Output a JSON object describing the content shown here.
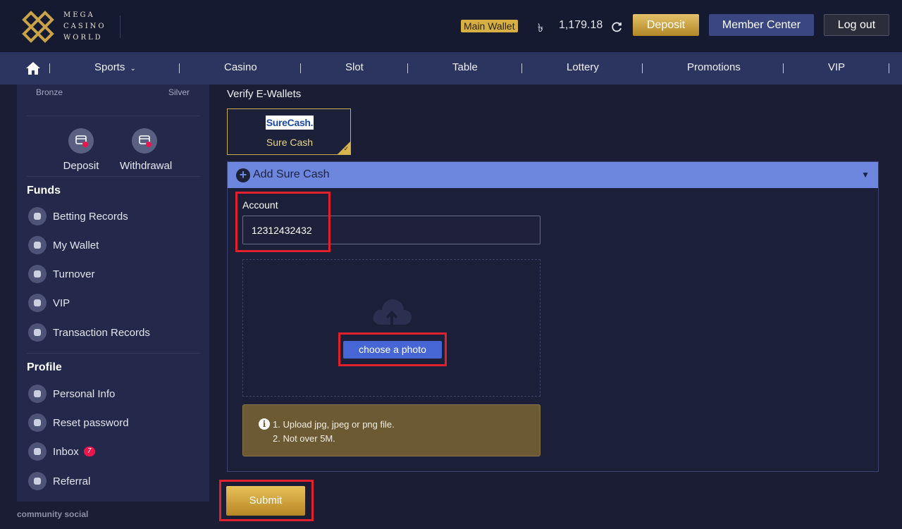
{
  "header": {
    "brand_line1": "MEGA",
    "brand_line2": "CASINO",
    "brand_line3": "WORLD",
    "wallet_label": "Main Wallet",
    "currency_symbol": "৳",
    "balance": "1,179.18",
    "deposit_label": "Deposit",
    "member_center_label": "Member Center",
    "logout_label": "Log out"
  },
  "nav": {
    "items": [
      "Sports",
      "Casino",
      "Slot",
      "Table",
      "Lottery",
      "Promotions",
      "VIP"
    ]
  },
  "sidebar": {
    "tier_left": "Bronze",
    "tier_right": "Silver",
    "quick": [
      "Deposit",
      "Withdrawal"
    ],
    "funds_title": "Funds",
    "funds_items": [
      "Betting Records",
      "My Wallet",
      "Turnover",
      "VIP",
      "Transaction Records"
    ],
    "profile_title": "Profile",
    "profile_items": [
      "Personal Info",
      "Reset password",
      "Inbox",
      "Referral"
    ],
    "inbox_count": "7",
    "community": "community social"
  },
  "main": {
    "title": "Verify E-Wallets",
    "wallet_logo_text": "SureCash.",
    "wallet_name": "Sure Cash",
    "panel_title": "Add Sure Cash",
    "account_label": "Account",
    "account_value": "12312432432",
    "choose_photo_label": "choose a photo",
    "note_line1": "1. Upload jpg, jpeg or png file.",
    "note_line2": "2. Not over 5M.",
    "submit_label": "Submit"
  },
  "colors": {
    "accent_gold": "#d7b043",
    "nav_bg": "#2c3560",
    "panel_head": "#6d86de",
    "highlight_red": "#e0202c"
  }
}
